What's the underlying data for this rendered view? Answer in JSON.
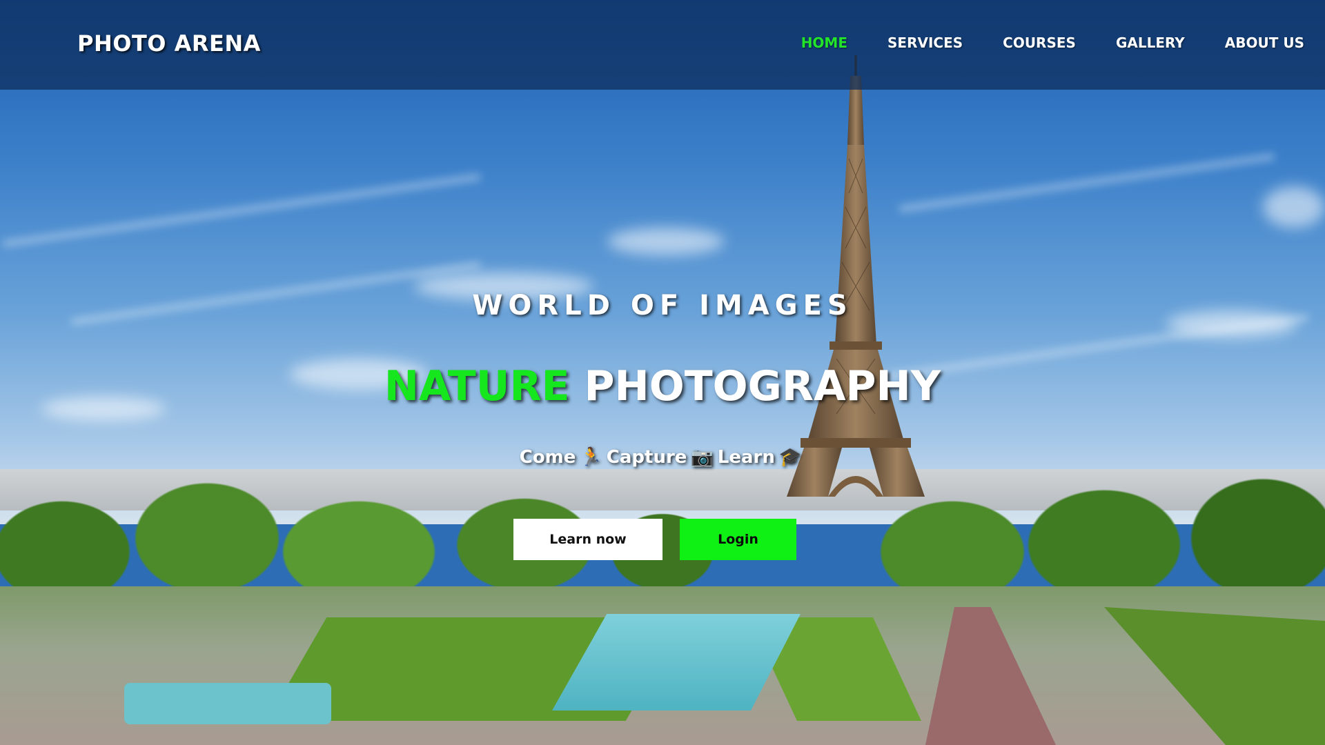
{
  "brand": {
    "name": "PHOTO ARENA"
  },
  "nav": {
    "items": [
      {
        "label": "HOME",
        "active": true
      },
      {
        "label": "SERVICES",
        "active": false
      },
      {
        "label": "COURSES",
        "active": false
      },
      {
        "label": "GALLERY",
        "active": false
      },
      {
        "label": "ABOUT US",
        "active": false
      }
    ]
  },
  "hero": {
    "tagline": "WORLD OF IMAGES",
    "headline_accent": "NATURE",
    "headline_rest": "PHOTOGRAPHY",
    "subline": {
      "word1": "Come",
      "icon1": "🏃",
      "word2": "Capture",
      "icon2": "📷",
      "word3": "Learn",
      "icon3": "🎓"
    },
    "buttons": {
      "learn_label": "Learn now",
      "login_label": "Login"
    }
  },
  "colors": {
    "accent_green": "#16e61e",
    "login_button": "#0ff014",
    "navbar": "#0c2d5a"
  }
}
